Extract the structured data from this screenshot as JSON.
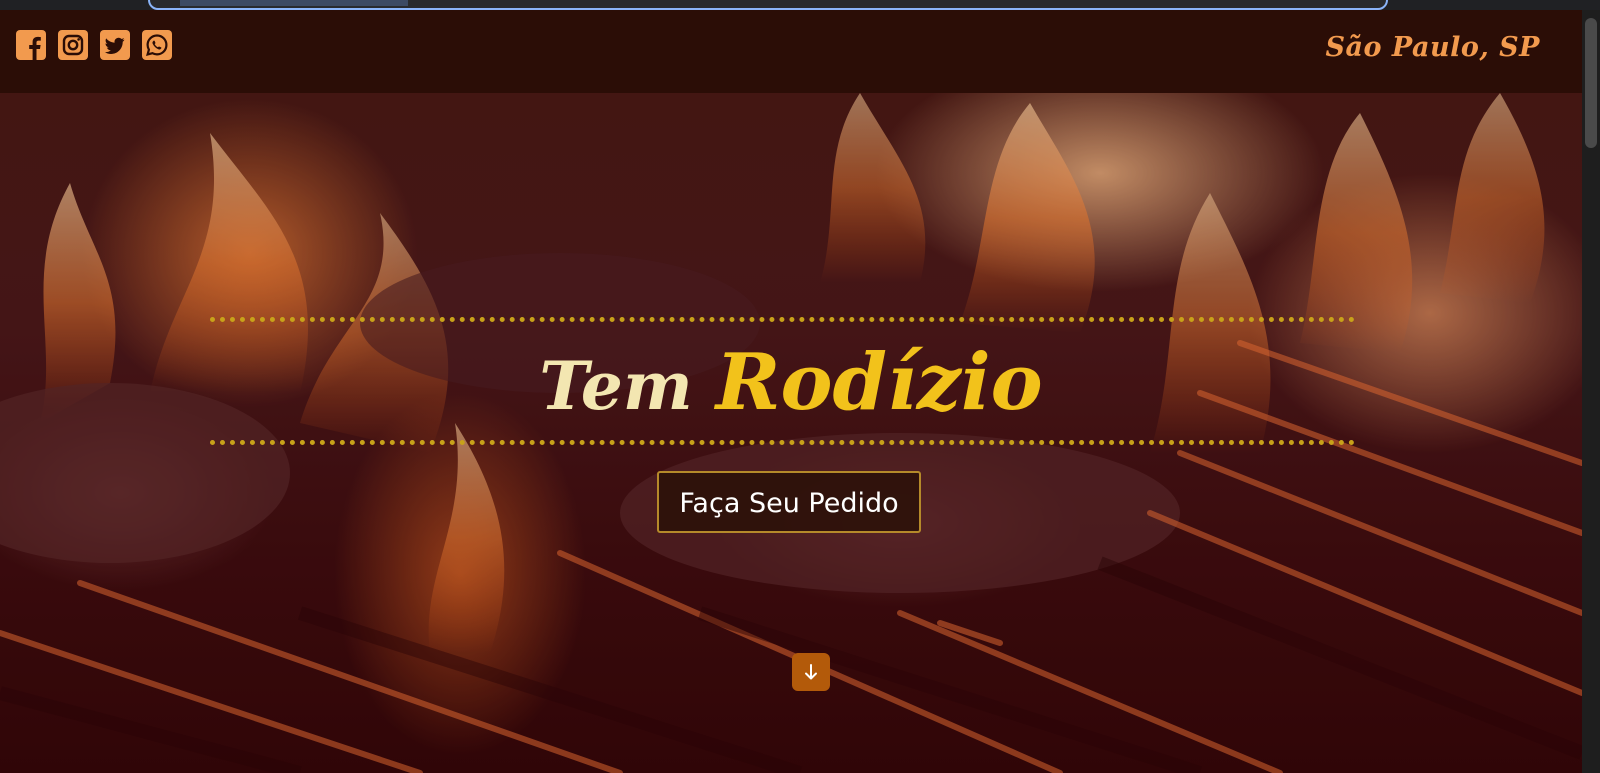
{
  "header": {
    "socials": [
      {
        "icon": "facebook-icon",
        "label": "Facebook"
      },
      {
        "icon": "instagram-icon",
        "label": "Instagram"
      },
      {
        "icon": "twitter-icon",
        "label": "Twitter"
      },
      {
        "icon": "whatsapp-icon",
        "label": "WhatsApp"
      }
    ],
    "city": "São Paulo, SP"
  },
  "hero": {
    "title_word1": "Tem",
    "title_word2": "Rodízio",
    "cta_label": "Faça Seu Pedido",
    "scroll_icon": "arrow-down-icon"
  },
  "colors": {
    "header_bg": "#2b0d06",
    "accent": "#f29a4e",
    "title_light": "#f3e6b1",
    "title_gold": "#f2c21b",
    "dots": "#c8a21a",
    "scroll_button": "#b35a0a"
  }
}
